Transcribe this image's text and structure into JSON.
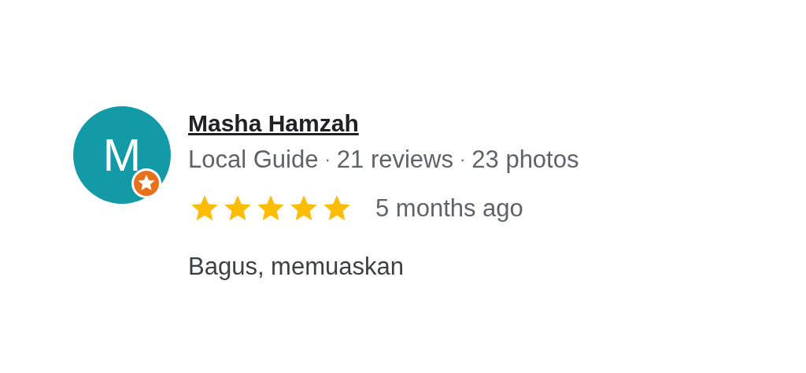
{
  "review": {
    "avatar_letter": "M",
    "name": "Masha Hamzah",
    "meta": [
      "Local Guide",
      "21 reviews",
      "23 photos"
    ],
    "separator": "·",
    "stars": 5,
    "time": "5 months ago",
    "text": "Bagus, memuaskan"
  }
}
